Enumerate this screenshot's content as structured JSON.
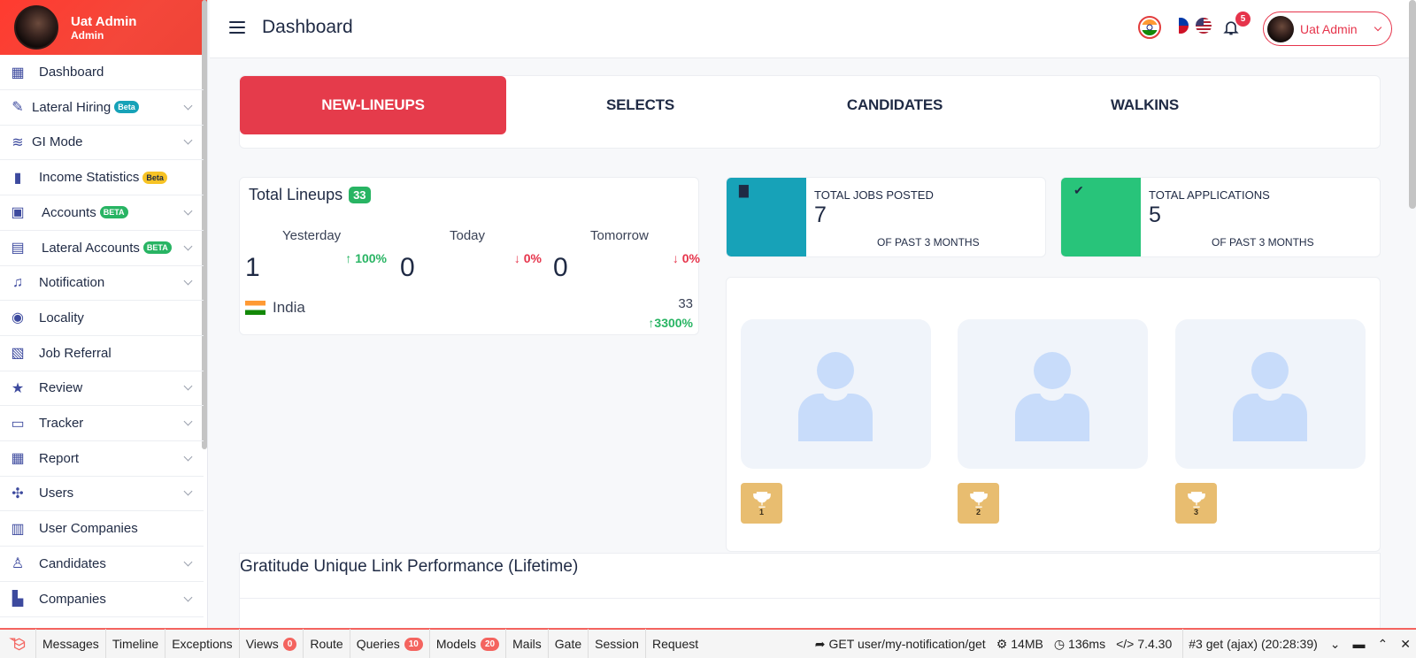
{
  "sidebar": {
    "user_name": "Uat Admin",
    "user_role": "Admin",
    "items": [
      {
        "label": "Dashboard",
        "icon": "dashboard-icon",
        "badge": "",
        "chevron": false
      },
      {
        "label": "Lateral Hiring",
        "icon": "handshake-icon",
        "badge": "Beta",
        "chevron": true
      },
      {
        "label": "GI Mode",
        "icon": "layers-icon",
        "badge": "",
        "chevron": true
      },
      {
        "label": "Income Statistics",
        "icon": "bar-chart-icon",
        "badge": "Beta",
        "chevron": false
      },
      {
        "label": "Accounts",
        "icon": "wallet-icon",
        "badge": "BETA",
        "chevron": true
      },
      {
        "label": "Lateral Accounts",
        "icon": "id-card-icon",
        "badge": "BETA",
        "chevron": true
      },
      {
        "label": "Notification",
        "icon": "bell-icon",
        "badge": "",
        "chevron": true
      },
      {
        "label": "Locality",
        "icon": "location-pin-icon",
        "badge": "",
        "chevron": false
      },
      {
        "label": "Job Referral",
        "icon": "briefcase-plus-icon",
        "badge": "",
        "chevron": false
      },
      {
        "label": "Review",
        "icon": "star-icon",
        "badge": "",
        "chevron": true
      },
      {
        "label": "Tracker",
        "icon": "layout-icon",
        "badge": "",
        "chevron": true
      },
      {
        "label": "Report",
        "icon": "report-icon",
        "badge": "",
        "chevron": true
      },
      {
        "label": "Users",
        "icon": "users-icon",
        "badge": "",
        "chevron": true
      },
      {
        "label": "User Companies",
        "icon": "building-icon",
        "badge": "",
        "chevron": false
      },
      {
        "label": "Candidates",
        "icon": "candidate-icon",
        "badge": "",
        "chevron": true
      },
      {
        "label": "Companies",
        "icon": "companies-icon",
        "badge": "",
        "chevron": true
      }
    ]
  },
  "header": {
    "title": "Dashboard",
    "notification_count": "5",
    "user_name": "Uat Admin"
  },
  "tabs": [
    {
      "label": "NEW-LINEUPS",
      "active": true
    },
    {
      "label": "SELECTS",
      "active": false
    },
    {
      "label": "CANDIDATES",
      "active": false
    },
    {
      "label": "WALKINS",
      "active": false
    }
  ],
  "lineups": {
    "title": "Total Lineups",
    "count": "33",
    "columns": [
      {
        "label": "Yesterday",
        "value": "1",
        "change": "100%",
        "direction": "up"
      },
      {
        "label": "Today",
        "value": "0",
        "change": "0%",
        "direction": "down"
      },
      {
        "label": "Tomorrow",
        "value": "0",
        "change": "0%",
        "direction": "down"
      }
    ],
    "country": "India",
    "country_total": "33",
    "country_change": "3300%"
  },
  "stats": [
    {
      "label": "TOTAL JOBS POSTED",
      "value": "7",
      "sub": "OF PAST 3 MONTHS",
      "color": "#17a2b8",
      "icon": "document-icon"
    },
    {
      "label": "TOTAL APPLICATIONS",
      "value": "5",
      "sub": "OF PAST 3 MONTHS",
      "color": "#28c47a",
      "icon": "check-icon"
    }
  ],
  "leaderboard": {
    "ranks": [
      "1",
      "2",
      "3"
    ]
  },
  "gratitude": {
    "title": "Gratitude Unique Link Performance (Lifetime)"
  },
  "debugbar": {
    "tabs": [
      {
        "label": "Messages",
        "count": ""
      },
      {
        "label": "Timeline",
        "count": ""
      },
      {
        "label": "Exceptions",
        "count": ""
      },
      {
        "label": "Views",
        "count": "0"
      },
      {
        "label": "Route",
        "count": ""
      },
      {
        "label": "Queries",
        "count": "10"
      },
      {
        "label": "Models",
        "count": "20"
      },
      {
        "label": "Mails",
        "count": ""
      },
      {
        "label": "Gate",
        "count": ""
      },
      {
        "label": "Session",
        "count": ""
      },
      {
        "label": "Request",
        "count": ""
      }
    ],
    "request": "GET user/my-notification/get",
    "memory": "14MB",
    "time": "136ms",
    "version": "7.4.30",
    "selected": "#3 get (ajax) (20:28:39)"
  },
  "colors": {
    "accent": "#e53b4b",
    "sidebar_header": "#f4473a",
    "icon": "#3d4a9e",
    "trophy": "#e8bd70"
  }
}
